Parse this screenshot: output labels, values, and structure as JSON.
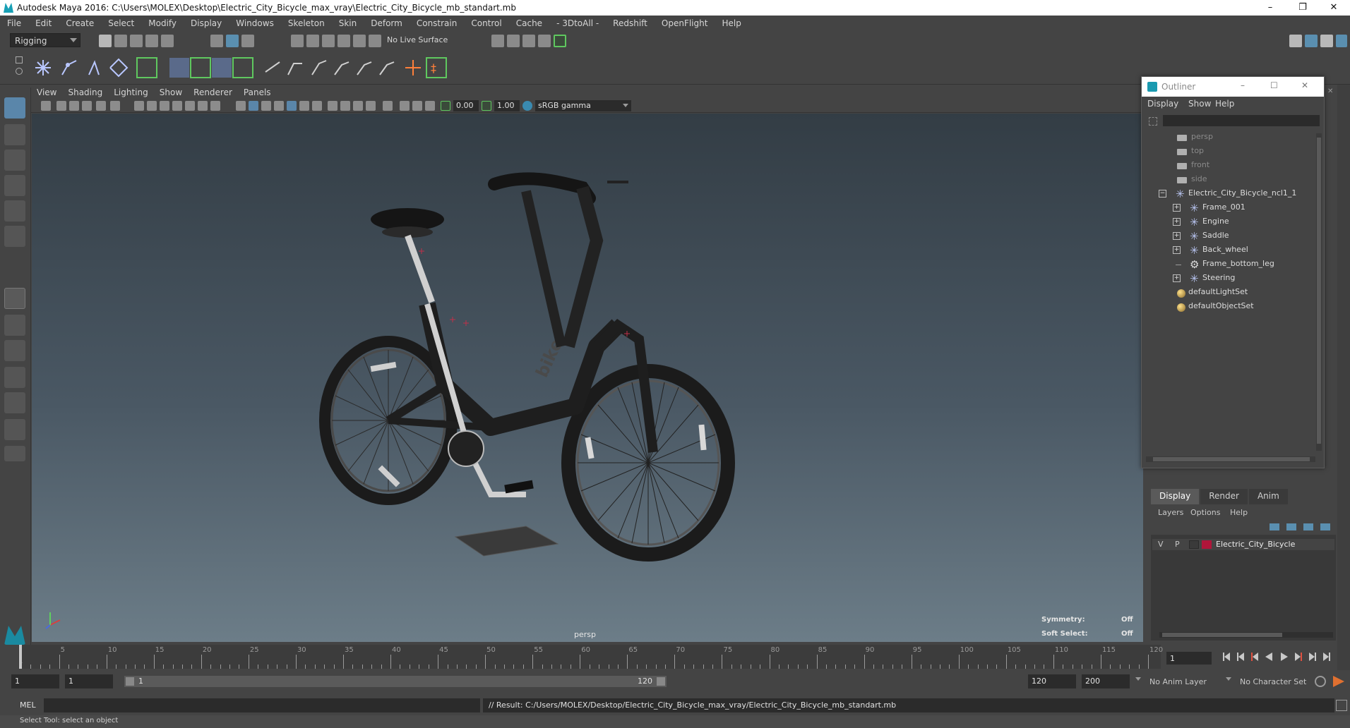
{
  "window": {
    "title": "Autodesk Maya 2016: C:\\Users\\MOLEX\\Desktop\\Electric_City_Bicycle_max_vray\\Electric_City_Bicycle_mb_standart.mb",
    "minimize": "–",
    "restore": "❐",
    "close": "✕"
  },
  "menubar": [
    "File",
    "Edit",
    "Create",
    "Select",
    "Modify",
    "Display",
    "Windows",
    "Skeleton",
    "Skin",
    "Deform",
    "Constrain",
    "Control",
    "Cache",
    "- 3DtoAll -",
    "Redshift",
    "OpenFlight",
    "Help"
  ],
  "statusline": {
    "menuset": "Rigging",
    "live_surface": "No Live Surface"
  },
  "viewport": {
    "menus": [
      "View",
      "Shading",
      "Lighting",
      "Show",
      "Renderer",
      "Panels"
    ],
    "exposure": "0.00",
    "gamma": "1.00",
    "colorspace": "sRGB gamma",
    "camera": "persp",
    "hud": {
      "symmetry_label": "Symmetry:",
      "symmetry_value": "Off",
      "soft_select_label": "Soft Select:",
      "soft_select_value": "Off"
    },
    "bike_logo": "bike"
  },
  "outliner": {
    "title": "Outliner",
    "menus": [
      "Display",
      "Show",
      "Help"
    ],
    "items": [
      {
        "label": "persp",
        "icon": "camera-icon"
      },
      {
        "label": "top",
        "icon": "camera-icon"
      },
      {
        "label": "front",
        "icon": "camera-icon"
      },
      {
        "label": "side",
        "icon": "camera-icon"
      },
      {
        "label": "Electric_City_Bicycle_ncl1_1",
        "icon": "joint-icon",
        "expand": "−"
      },
      {
        "label": "Frame_001",
        "icon": "joint-icon",
        "expand": "+"
      },
      {
        "label": "Engine",
        "icon": "joint-icon",
        "expand": "+"
      },
      {
        "label": "Saddle",
        "icon": "joint-icon",
        "expand": "+"
      },
      {
        "label": "Back_wheel",
        "icon": "joint-icon",
        "expand": "+"
      },
      {
        "label": "Frame_bottom_leg",
        "icon": "mesh-icon"
      },
      {
        "label": "Steering",
        "icon": "joint-icon",
        "expand": "+"
      },
      {
        "label": "defaultLightSet",
        "icon": "set-icon"
      },
      {
        "label": "defaultObjectSet",
        "icon": "set-icon"
      }
    ]
  },
  "layer_editor": {
    "tabs": [
      "Display",
      "Render",
      "Anim"
    ],
    "menus": [
      "Layers",
      "Options",
      "Help"
    ],
    "layer": {
      "v": "V",
      "p": "P",
      "name": "Electric_City_Bicycle",
      "color": "#b0163a"
    }
  },
  "timeline": {
    "labels": [
      "5",
      "10",
      "15",
      "20",
      "25",
      "30",
      "35",
      "40",
      "45",
      "50",
      "55",
      "60",
      "65",
      "70",
      "75",
      "80",
      "85",
      "90",
      "95",
      "100",
      "105",
      "110",
      "115",
      "120"
    ],
    "start_label": "1",
    "current_frame": "1"
  },
  "range": {
    "start": "1",
    "anim_start": "1",
    "range_start": "1",
    "range_end": "120",
    "anim_end": "120",
    "end": "200",
    "anim_layer": "No Anim Layer",
    "character_set": "No Character Set"
  },
  "cmdline": {
    "lang": "MEL",
    "result": "// Result: C:/Users/MOLEX/Desktop/Electric_City_Bicycle_max_vray/Electric_City_Bicycle_mb_standart.mb"
  },
  "helpline": "Select Tool: select an object",
  "colors": {
    "accent_green": "#5fc85f",
    "layer_red": "#b0163a",
    "timeline_bg": "#3c3c3c"
  }
}
